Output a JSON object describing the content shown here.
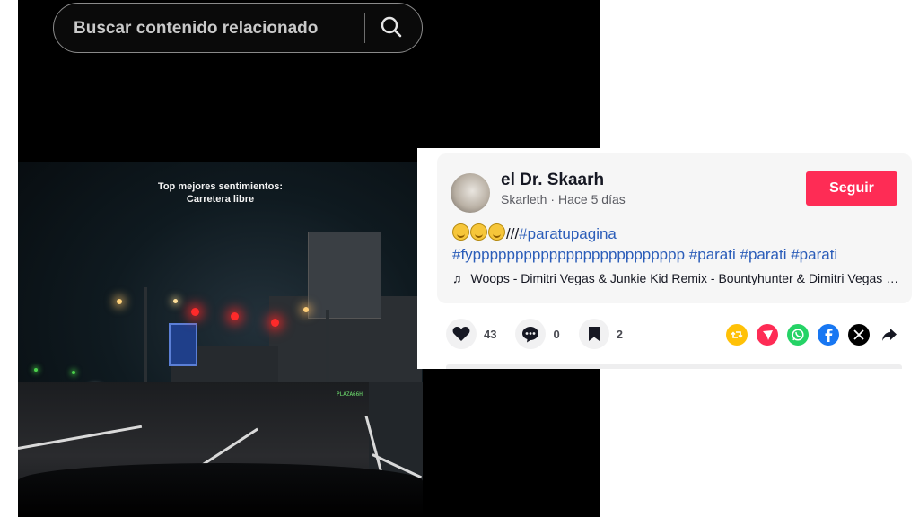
{
  "search": {
    "placeholder": "Buscar contenido relacionado",
    "button_icon": "search-icon"
  },
  "video": {
    "caption_line1": "Top mejores sentimientos:",
    "caption_line2": "Carretera libre",
    "sign_text": "PLAZA66H"
  },
  "post": {
    "author_name": "el Dr. Skaarh",
    "username": "Skarleth",
    "separator": "·",
    "time": "Hace 5 días",
    "follow_label": "Seguir",
    "description_slashes": "///",
    "hashtags": [
      "#paratupagina",
      "#fyppppppppppppppppppppppppp",
      "#parati",
      "#parati",
      "#parati"
    ],
    "music_icon": "♫",
    "music": "Woops - Dimitri Vegas & Junkie Kid Remix - Bountyhunter & Dimitri Vegas & Junkie Kid"
  },
  "actions": {
    "likes": "43",
    "comments": "0",
    "saves": "2"
  },
  "share_icons": [
    "repost-icon",
    "send-icon",
    "whatsapp-icon",
    "facebook-icon",
    "x-icon",
    "share-arrow-icon"
  ],
  "colors": {
    "follow": "#fe2c55",
    "hashtag": "#2b5db9",
    "repost": "#ffc107",
    "send": "#fe2c55",
    "whatsapp": "#25d366",
    "facebook": "#1877f2",
    "x": "#000000"
  }
}
